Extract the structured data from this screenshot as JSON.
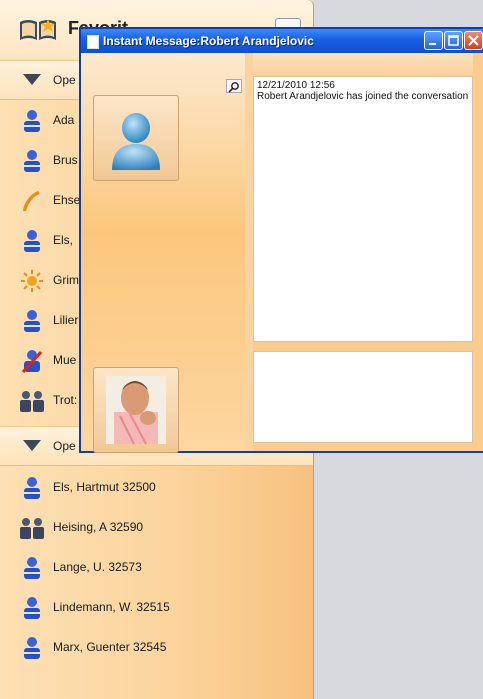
{
  "contacts_panel": {
    "title": "Favorit",
    "groups": [
      {
        "label": "Ope",
        "contacts": [
          {
            "name": "Ada",
            "icon": "person-blue-icon"
          },
          {
            "name": "Brus",
            "icon": "person-blue-icon"
          },
          {
            "name": "Ehse",
            "icon": "phone-handset-icon"
          },
          {
            "name": "Els, ",
            "icon": "person-blue-icon"
          },
          {
            "name": "Grim",
            "icon": "sun-away-icon"
          },
          {
            "name": "Lilier",
            "icon": "person-blue-icon"
          },
          {
            "name": "Mue",
            "icon": "person-busy-icon"
          },
          {
            "name": "Trot:",
            "icon": "group-icon"
          }
        ]
      },
      {
        "label": "Ope",
        "contacts": [
          {
            "name": "Els, Hartmut  32500",
            "icon": "person-blue-icon"
          },
          {
            "name": "Heising, A  32590",
            "icon": "group-icon"
          },
          {
            "name": "Lange, U.  32573",
            "icon": "person-blue-icon"
          },
          {
            "name": "Lindemann, W.  32515",
            "icon": "person-blue-icon"
          },
          {
            "name": "Marx, Guenter  32545",
            "icon": "person-blue-icon"
          }
        ]
      }
    ]
  },
  "im_window": {
    "title": "Instant Message:Robert Arandjelovic",
    "transcript": {
      "timestamp": "12/21/2010 12:56",
      "message": "Robert Arandjelovic has joined the conversation"
    },
    "compose_value": ""
  },
  "colors": {
    "titlebar": "#1a5fe2",
    "panel_orange": "#fcd49d",
    "close_red": "#d4401f"
  }
}
